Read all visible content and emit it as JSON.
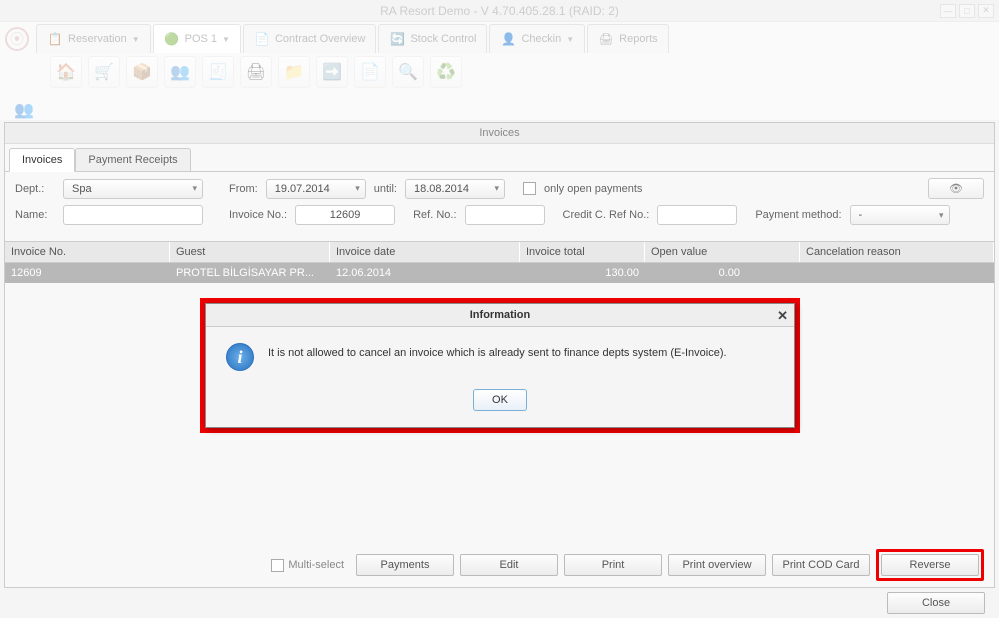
{
  "window": {
    "title": "RA Resort Demo - V 4.70.405.28.1 (RAID: 2)"
  },
  "mainTabs": {
    "reservation": "Reservation",
    "pos": "POS 1",
    "contract": "Contract Overview",
    "stock": "Stock Control",
    "checkin": "Checkin",
    "reports": "Reports"
  },
  "panel": {
    "title": "Invoices",
    "tabs": {
      "invoices": "Invoices",
      "payment": "Payment Receipts"
    }
  },
  "filters": {
    "deptLabel": "Dept.:",
    "deptValue": "Spa",
    "fromLabel": "From:",
    "fromValue": "19.07.2014",
    "untilLabel": "until:",
    "untilValue": "18.08.2014",
    "onlyOpen": "only open payments",
    "nameLabel": "Name:",
    "invoiceNoLabel": "Invoice No.:",
    "invoiceNoValue": "12609",
    "refNoLabel": "Ref. No.:",
    "creditRefLabel": "Credit C. Ref No.:",
    "payMethodLabel": "Payment method:",
    "payMethodValue": "-"
  },
  "table": {
    "headers": {
      "invoiceNo": "Invoice No.",
      "guest": "Guest",
      "date": "Invoice date",
      "total": "Invoice total",
      "open": "Open value",
      "cancel": "Cancelation reason"
    },
    "row": {
      "invoiceNo": "12609",
      "guest": "PROTEL BİLGİSAYAR PR...",
      "date": "12.06.2014",
      "total": "130.00",
      "open": "0.00",
      "cancel": ""
    }
  },
  "buttons": {
    "multiSelect": "Multi-select",
    "payments": "Payments",
    "edit": "Edit",
    "print": "Print",
    "printOverview": "Print overview",
    "printCod": "Print COD Card",
    "reverse": "Reverse",
    "close": "Close"
  },
  "modal": {
    "title": "Information",
    "text": "It is not allowed to cancel an invoice which is already sent to finance depts system (E-Invoice).",
    "ok": "OK"
  }
}
